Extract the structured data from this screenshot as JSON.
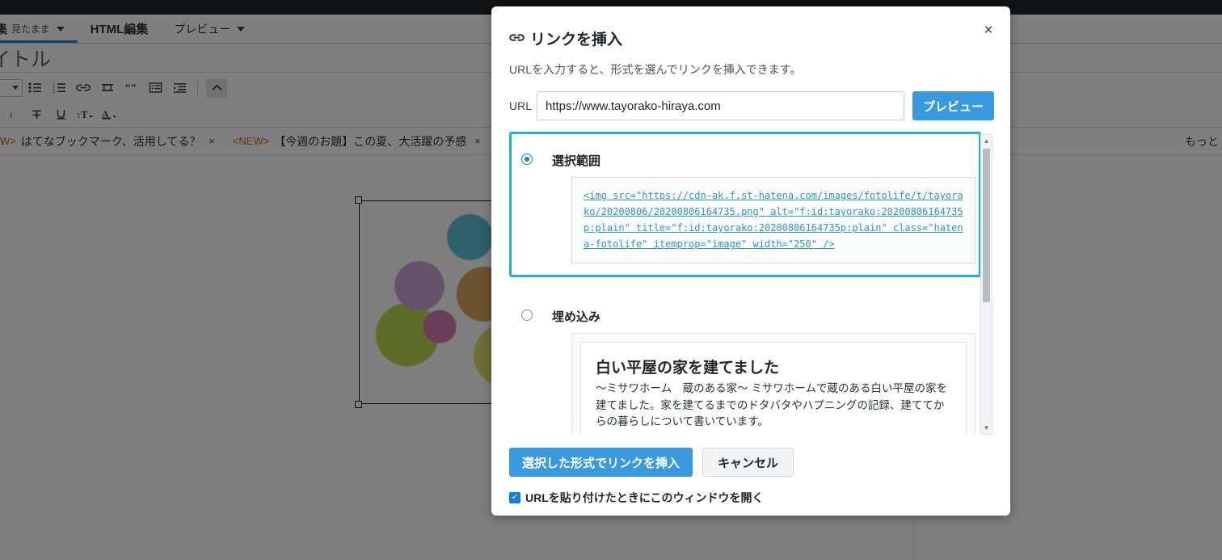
{
  "background": {
    "editor_tabs": [
      {
        "label": "集",
        "sub": "見たまま",
        "active": true,
        "has_caret": true
      },
      {
        "label": "HTML編集",
        "sub": "",
        "active": false,
        "has_caret": false
      },
      {
        "label": "プレビュー",
        "sub": "",
        "active": false,
        "has_caret": true
      }
    ],
    "title_placeholder": "イトル",
    "toolbar_row1_icons": [
      "font-size-select",
      "bullet-list-icon",
      "numbered-list-icon",
      "link-icon",
      "table-icon",
      "quote-icon",
      "definition-list-icon",
      "indent-icon",
      "collapse-toolbar-icon"
    ],
    "toolbar_row2_icons": [
      "italic-icon",
      "strikethrough-icon",
      "underline-icon",
      "font-size-icon",
      "font-color-icon"
    ],
    "notices": [
      {
        "tag": "W>",
        "text": "はてなブックマーク、活用してる？",
        "close": "×"
      },
      {
        "tag": "<NEW>",
        "text": "【今週のお題】この夏、大活躍の予感",
        "close": "×"
      }
    ],
    "notice_more": "もっと"
  },
  "modal": {
    "title": "リンクを挿入",
    "title_icon": "link-icon",
    "close_icon": "×",
    "description": "URLを入力すると、形式を選んでリンクを挿入できます。",
    "url": {
      "label": "URL",
      "value": "https://www.tayorako-hiraya.com",
      "placeholder": "https://",
      "preview_button": "プレビュー"
    },
    "options": [
      {
        "label": "選択範囲",
        "selected": true,
        "code": "<img src=\"https://cdn-ak.f.st-hatena.com/images/fotolife/t/tayorako/20200806/20200806164735.png\" alt=\"f:id:tayorako:20200806164735p:plain\" title=\"f:id:tayorako:20200806164735p:plain\" class=\"hatena-fotolife\" itemprop=\"image\" width=\"250\" />"
      },
      {
        "label": "埋め込み",
        "selected": false,
        "card_title": "白い平屋の家を建てました",
        "card_summary": "〜ミサワホーム　蔵のある家〜 ミサワホームで蔵のある白い平屋の家を建てました。家を建てるまでのドタバタやハプニングの記録、建ててからの暮らしについて書いています。"
      }
    ],
    "footer": {
      "submit_label": "選択した形式でリンクを挿入",
      "cancel_label": "キャンセル",
      "checkbox_label": "URLを貼り付けたときにこのウィンドウを開く",
      "checkbox_checked": true,
      "check_glyph": "✓"
    }
  },
  "colors": {
    "accent_blue": "#3a9ae0",
    "highlight_cyan": "#21b0e0",
    "code_link": "#2d96c9",
    "tab_active_underline": "#2b7bd4",
    "notice_tag": "#c06a1e"
  }
}
